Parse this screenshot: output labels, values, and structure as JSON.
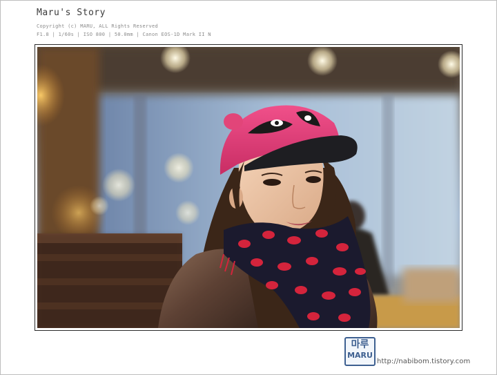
{
  "header": {
    "title": "Maru's Story",
    "copyright": "Copyright (c) MARU, ALL Rights Reserved",
    "exif": "F1.8 | 1/60s | ISO 800 | 50.0mm | Canon EOS-1D Mark II N"
  },
  "photo": {
    "subject": "woman in pink cap with eye decals and red-lips scarf"
  },
  "footer": {
    "logo_korean": "마루",
    "logo_latin": "MARU",
    "url": "http://nabibom.tistory.com"
  }
}
